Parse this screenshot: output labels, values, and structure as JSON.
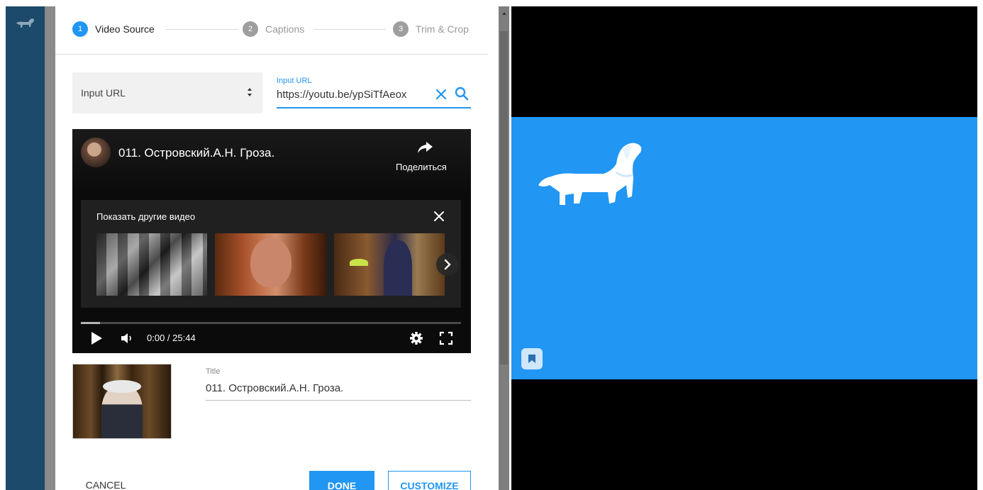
{
  "stepper": {
    "steps": [
      {
        "number": "1",
        "label": "Video Source",
        "state": "active"
      },
      {
        "number": "2",
        "label": "Captions",
        "state": "inactive"
      },
      {
        "number": "3",
        "label": "Trim & Crop",
        "state": "inactive"
      }
    ]
  },
  "source": {
    "selected": "Input URL",
    "url_field_label": "Input URL",
    "url_value": "https://youtu.be/ypSiTfAeox"
  },
  "player": {
    "video_title": "011. Островский.А.Н. Гроза.",
    "share_label": "Поделиться",
    "more_videos_title": "Показать другие видео",
    "time": "0:00 / 25:44",
    "progress_fraction": 0.05
  },
  "details": {
    "title_label": "Title",
    "title_value": "011. Островский.А.Н. Гроза."
  },
  "actions": {
    "cancel": "CANCEL",
    "done": "DONE",
    "customize": "CUSTOMIZE"
  },
  "colors": {
    "accent": "#2196f3",
    "sidebar": "#1b4a6b",
    "preview_banner": "#2196f3"
  },
  "icons": [
    "dog-logo-icon",
    "sort-arrows-icon",
    "clear-icon",
    "search-icon",
    "share-icon",
    "close-icon",
    "chevron-right-icon",
    "play-icon",
    "volume-icon",
    "settings-icon",
    "fullscreen-icon",
    "bookmark-icon"
  ]
}
